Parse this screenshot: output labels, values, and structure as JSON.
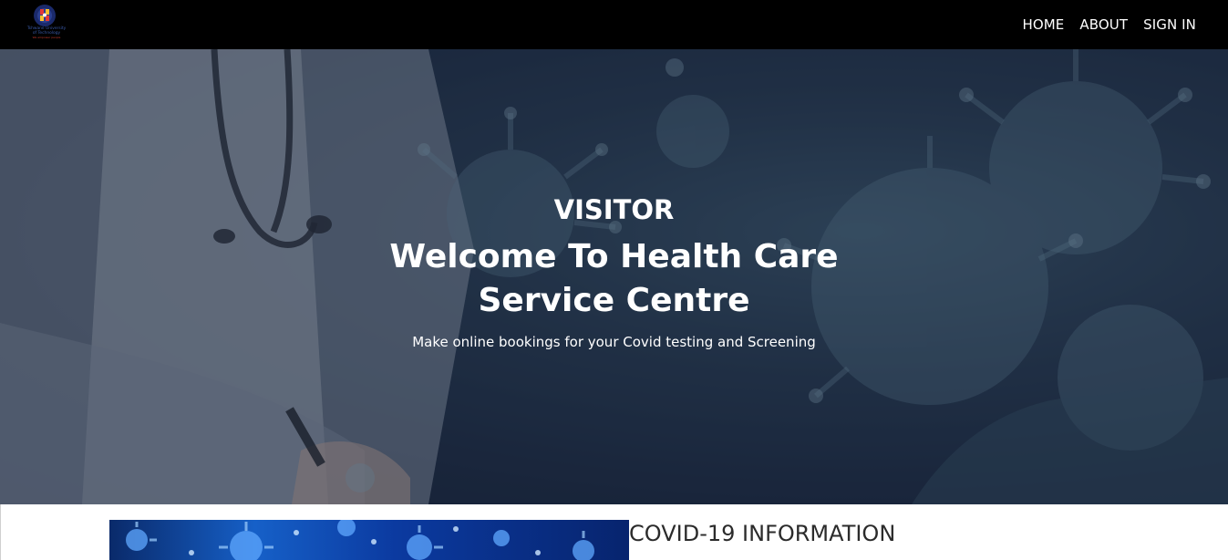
{
  "brand": {
    "logo_text_line1": "Tshwane University",
    "logo_text_line2": "of Technology",
    "logo_text_line3": "We empower people"
  },
  "nav": {
    "items": [
      {
        "label": "HOME"
      },
      {
        "label": "ABOUT"
      },
      {
        "label": "SIGN IN"
      }
    ]
  },
  "hero": {
    "kicker": "VISITOR",
    "title": "Welcome To Health Care Service Centre",
    "subtitle": "Make online bookings for your Covid testing and Screening"
  },
  "info": {
    "heading": "COVID-19 INFORMATION"
  },
  "colors": {
    "navbar": "#000000",
    "hero_overlay": "#1e2c44",
    "text_light": "#ffffff",
    "heading_dark": "#2b2b2b"
  }
}
